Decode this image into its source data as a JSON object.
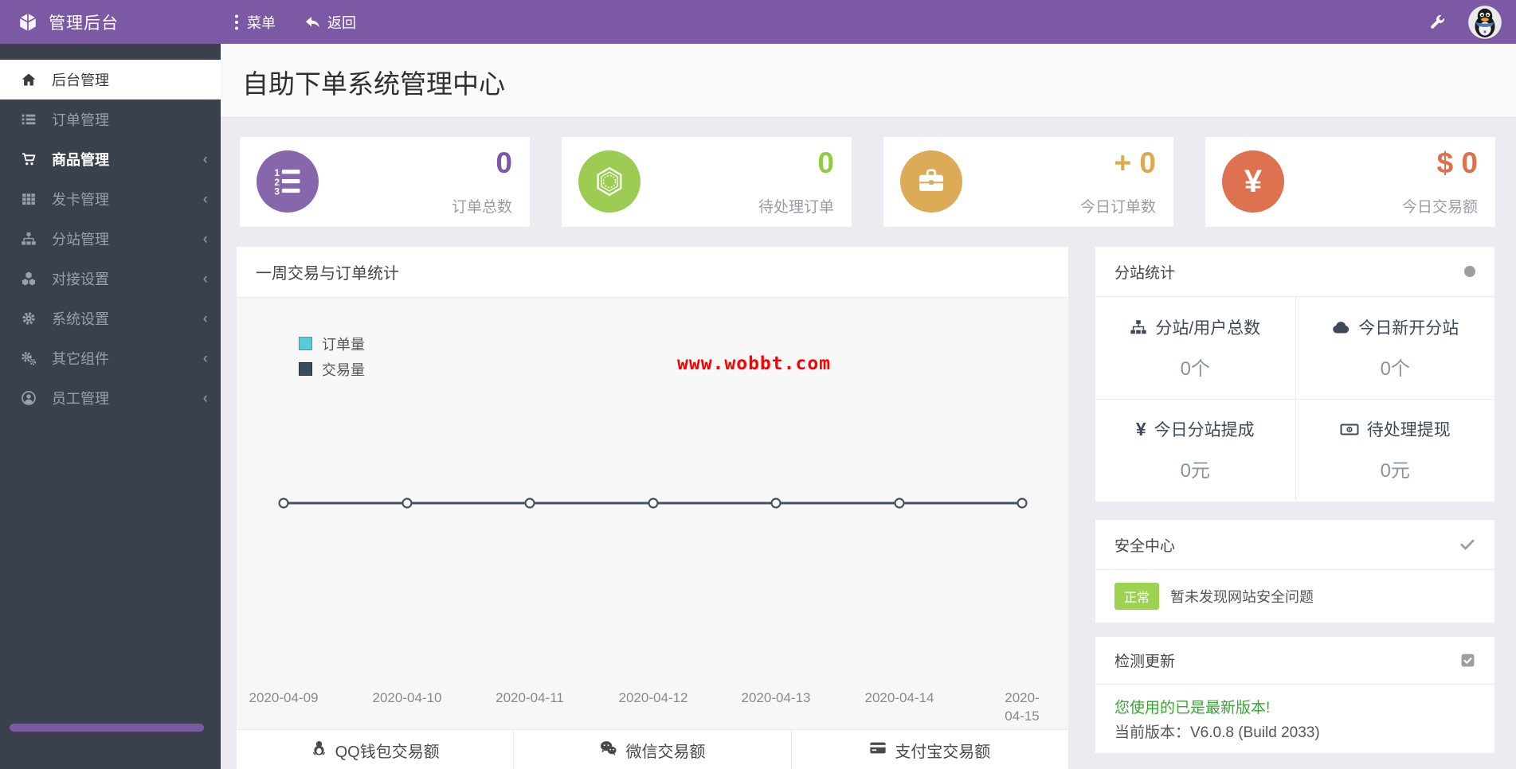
{
  "colors": {
    "topbar": "#7c59a5",
    "sidebar": "#3a414d",
    "stat_purple": "#8767ac",
    "stat_green": "#9ccd52",
    "stat_gold": "#dcab57",
    "stat_orange": "#dd7150",
    "legend_orders": "#57cbd9",
    "legend_trades": "#3e4a59",
    "badge_green": "#9ed351",
    "update_green": "#35a82f",
    "watermark_red": "#fe0000"
  },
  "topbar": {
    "brand": "管理后台",
    "menu": "菜单",
    "back": "返回"
  },
  "sidebar": {
    "items": [
      {
        "label": "后台管理",
        "icon": "home-icon",
        "active": true,
        "chevron": false
      },
      {
        "label": "订单管理",
        "icon": "list-icon",
        "active": false,
        "chevron": false
      },
      {
        "label": "商品管理",
        "icon": "cart-icon",
        "active": false,
        "chevron": true
      },
      {
        "label": "发卡管理",
        "icon": "grid-icon",
        "active": false,
        "chevron": true
      },
      {
        "label": "分站管理",
        "icon": "sitemap-icon",
        "active": false,
        "chevron": true
      },
      {
        "label": "对接设置",
        "icon": "cubes-icon",
        "active": false,
        "chevron": true
      },
      {
        "label": "系统设置",
        "icon": "gear-icon",
        "active": false,
        "chevron": true
      },
      {
        "label": "其它组件",
        "icon": "gears-icon",
        "active": false,
        "chevron": true
      },
      {
        "label": "员工管理",
        "icon": "user-icon",
        "active": false,
        "chevron": true
      }
    ]
  },
  "page": {
    "title": "自助下单系统管理中心"
  },
  "stats": [
    {
      "value": "0",
      "label": "订单总数",
      "icon": "ordered-list-icon",
      "color": "#8767ac"
    },
    {
      "value": "0",
      "label": "待处理订单",
      "icon": "gem-icon",
      "color": "#9ccd52"
    },
    {
      "value": "+ 0",
      "label": "今日订单数",
      "icon": "briefcase-icon",
      "color": "#dcab57"
    },
    {
      "value": "$ 0",
      "label": "今日交易额",
      "icon": "yen-icon",
      "color": "#dd7150"
    }
  ],
  "chart_data": {
    "type": "line",
    "title": "一周交易与订单统计",
    "x": [
      "2020-04-09",
      "2020-04-10",
      "2020-04-11",
      "2020-04-12",
      "2020-04-13",
      "2020-04-14",
      "2020-04-15"
    ],
    "series": [
      {
        "name": "订单量",
        "values": [
          0,
          0,
          0,
          0,
          0,
          0,
          0
        ],
        "color": "#57cbd9"
      },
      {
        "name": "交易量",
        "values": [
          0,
          0,
          0,
          0,
          0,
          0,
          0
        ],
        "color": "#3e4a59"
      }
    ],
    "legend_position": "top-left",
    "grid": false,
    "watermark": "www.wobbt.com"
  },
  "payment_tabs": [
    {
      "label": "QQ钱包交易额",
      "icon": "qq-icon"
    },
    {
      "label": "微信交易额",
      "icon": "wechat-icon"
    },
    {
      "label": "支付宝交易额",
      "icon": "bank-card-icon"
    }
  ],
  "substation": {
    "title": "分站统计",
    "cells": [
      {
        "icon": "sitemap-icon",
        "label": "分站/用户总数",
        "value": "0个"
      },
      {
        "icon": "cloud-icon",
        "label": "今日新开分站",
        "value": "0个"
      },
      {
        "icon": "yen-icon",
        "label": "今日分站提成",
        "value": "0元"
      },
      {
        "icon": "money-bill-icon",
        "label": "待处理提现",
        "value": "0元"
      }
    ]
  },
  "security": {
    "title": "安全中心",
    "badge": "正常",
    "text": "暂未发现网站安全问题"
  },
  "update": {
    "title": "检测更新",
    "message": "您使用的已是最新版本!",
    "version": "当前版本：V6.0.8 (Build 2033)"
  }
}
